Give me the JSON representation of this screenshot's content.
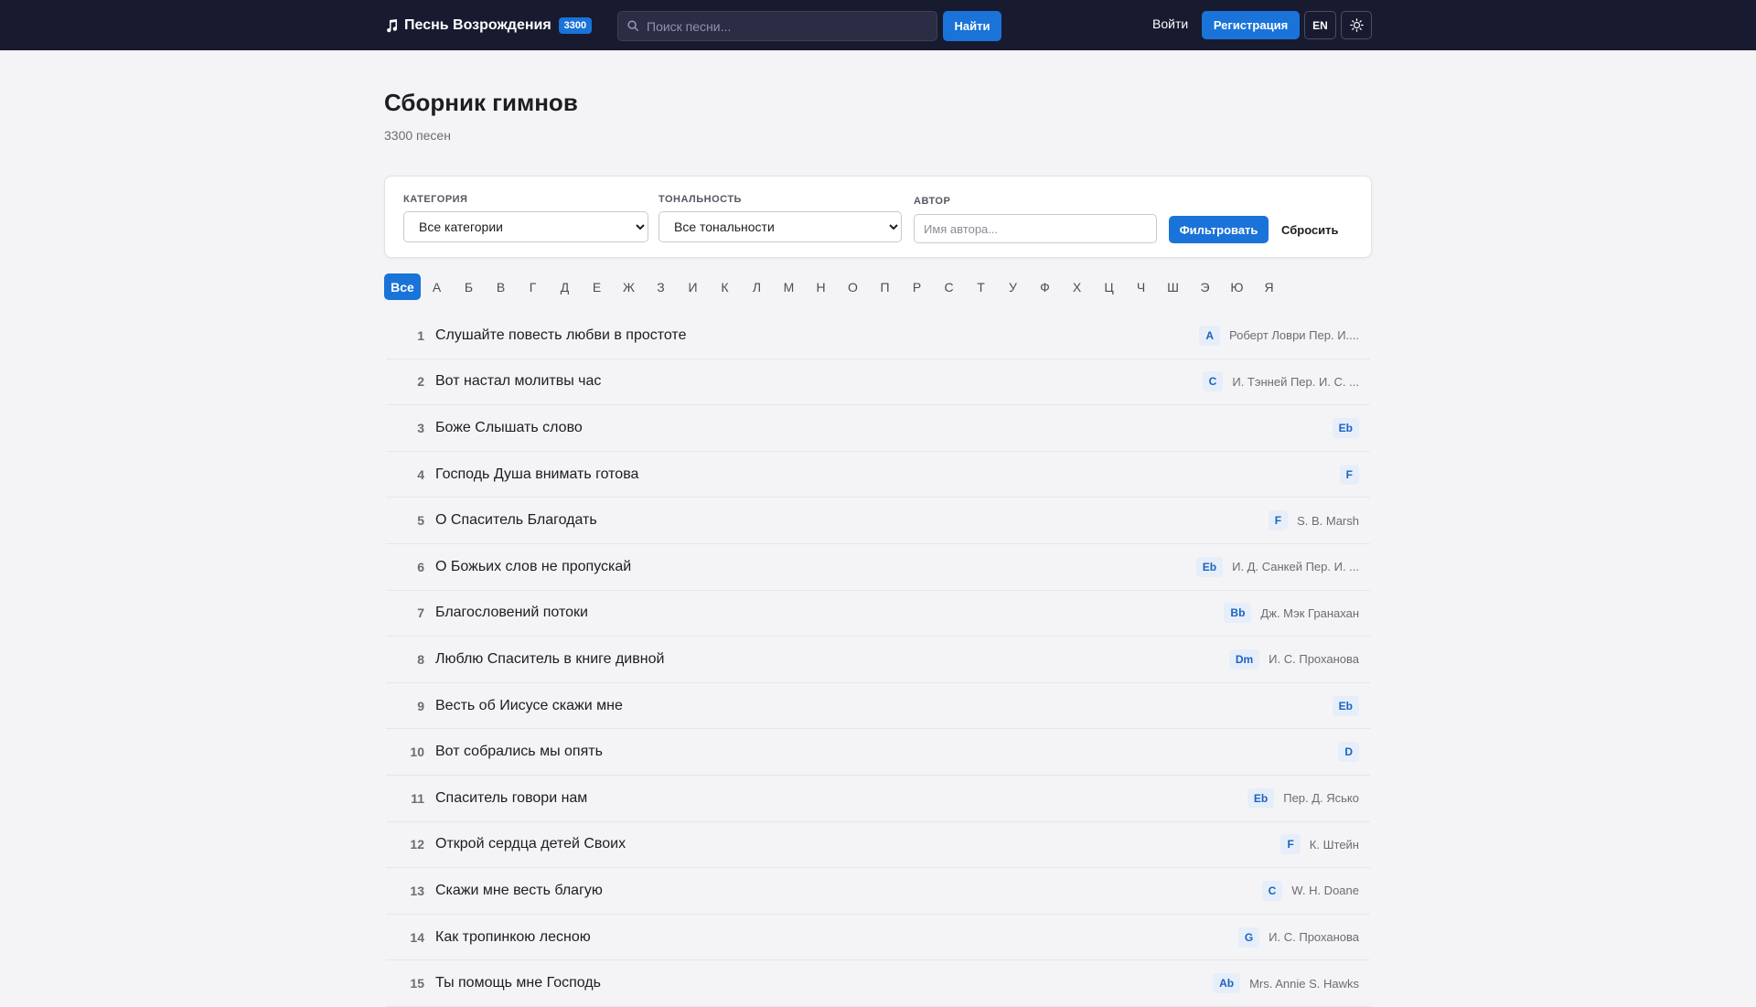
{
  "header": {
    "brand": "Песнь Возрождения",
    "count_badge": "3300",
    "search_placeholder": "Поиск песни...",
    "search_button": "Найти",
    "login": "Войти",
    "register": "Регистрация",
    "lang": "EN",
    "icons": {
      "brand": "music-note-icon",
      "search": "search-icon",
      "theme": "sun-icon"
    }
  },
  "page": {
    "title": "Сборник гимнов",
    "subtitle": "3300 песен"
  },
  "filters": {
    "category_label": "КАТЕГОРИЯ",
    "category_value": "Все категории",
    "key_label": "ТОНАЛЬНОСТЬ",
    "key_value": "Все тональности",
    "author_label": "АВТОР",
    "author_placeholder": "Имя автора...",
    "filter_button": "Фильтровать",
    "reset_button": "Сбросить"
  },
  "alphabet": [
    "Все",
    "А",
    "Б",
    "В",
    "Г",
    "Д",
    "Е",
    "Ж",
    "З",
    "И",
    "К",
    "Л",
    "М",
    "Н",
    "О",
    "П",
    "Р",
    "С",
    "Т",
    "У",
    "Ф",
    "Х",
    "Ц",
    "Ч",
    "Ш",
    "Э",
    "Ю",
    "Я"
  ],
  "alphabet_active": "Все",
  "songs": [
    {
      "num": "1",
      "title": "Слушайте повесть любви в простоте",
      "key": "A",
      "author": "Роберт Ловри Пер. И...."
    },
    {
      "num": "2",
      "title": "Вот настал молитвы час",
      "key": "C",
      "author": "И. Тэнней Пер. И. С. ..."
    },
    {
      "num": "3",
      "title": "Боже Слышать слово",
      "key": "Eb",
      "author": ""
    },
    {
      "num": "4",
      "title": "Господь Душа внимать готова",
      "key": "F",
      "author": ""
    },
    {
      "num": "5",
      "title": "О Спаситель Благодать",
      "key": "F",
      "author": "S. B. Marsh"
    },
    {
      "num": "6",
      "title": "О Божьих слов не пропускай",
      "key": "Eb",
      "author": "И. Д. Санкей Пер. И. ..."
    },
    {
      "num": "7",
      "title": "Благословений потоки",
      "key": "Bb",
      "author": "Дж. Мэк Гранахан"
    },
    {
      "num": "8",
      "title": "Люблю Спаситель в книге дивной",
      "key": "Dm",
      "author": "И. С. Проханова"
    },
    {
      "num": "9",
      "title": "Весть об Иисусе скажи мне",
      "key": "Eb",
      "author": ""
    },
    {
      "num": "10",
      "title": "Вот собрались мы опять",
      "key": "D",
      "author": ""
    },
    {
      "num": "11",
      "title": "Спаситель говори нам",
      "key": "Eb",
      "author": "Пер. Д. Ясько"
    },
    {
      "num": "12",
      "title": "Открой сердца детей Своих",
      "key": "F",
      "author": "К. Штейн"
    },
    {
      "num": "13",
      "title": "Скажи мне весть благую",
      "key": "C",
      "author": "W. H. Doane"
    },
    {
      "num": "14",
      "title": "Как тропинкою лесною",
      "key": "G",
      "author": "И. С. Проханова"
    },
    {
      "num": "15",
      "title": "Ты помощь мне Господь",
      "key": "Ab",
      "author": "Mrs. Annie S. Hawks"
    }
  ],
  "colors": {
    "header_bg": "#181a30",
    "accent": "#1a73d8",
    "page_bg": "#f4f4f6"
  }
}
